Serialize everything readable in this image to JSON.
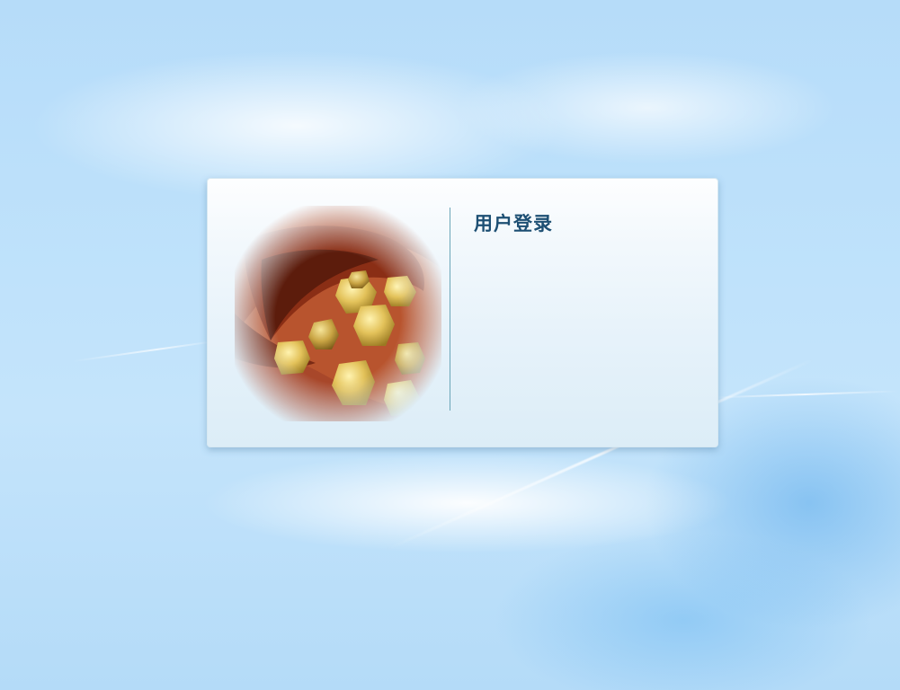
{
  "login_panel": {
    "title": "用户登录"
  },
  "colors": {
    "background": "#bfe2fb",
    "panel_title": "#1d4f73",
    "divider": "#6ca6b8"
  }
}
